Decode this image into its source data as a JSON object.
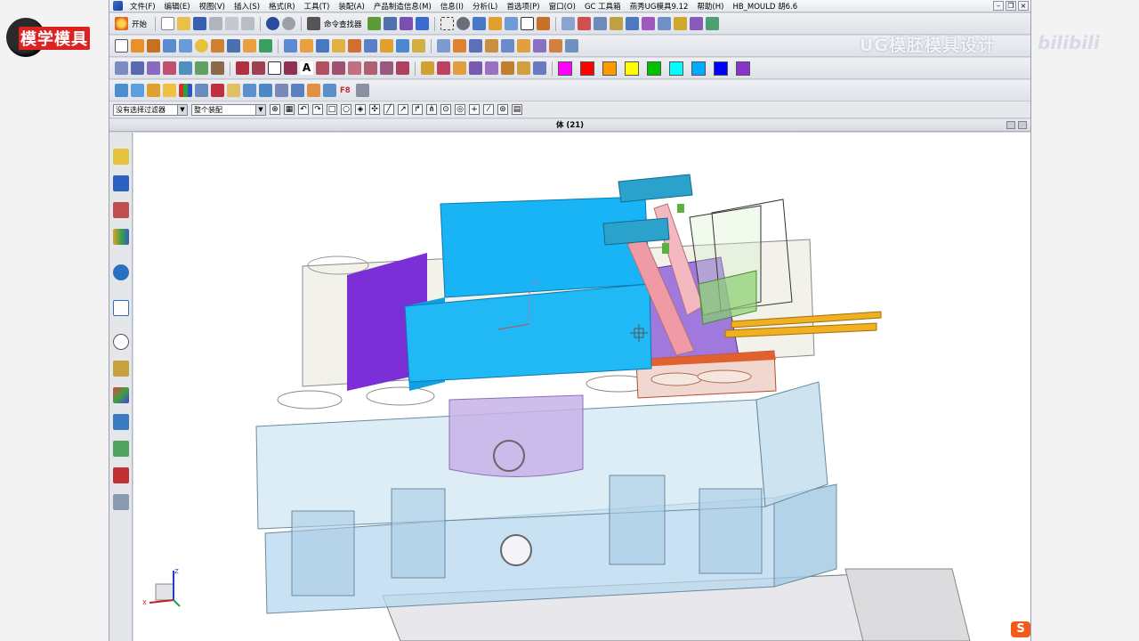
{
  "menu": {
    "items": [
      "文件(F)",
      "编辑(E)",
      "视图(V)",
      "插入(S)",
      "格式(R)",
      "工具(T)",
      "装配(A)",
      "产品制造信息(M)",
      "信息(I)",
      "分析(L)",
      "首选项(P)",
      "窗口(O)",
      "GC 工具箱",
      "燕秀UG模具9.12",
      "帮助(H)",
      "HB_MOULD 胡6.6"
    ]
  },
  "toolbar1": {
    "start_label": "开始",
    "command_finder_label": "命令查找器"
  },
  "colors": {
    "palette": [
      "#ff00ff",
      "#ff0000",
      "#ff9900",
      "#ffff00",
      "#00c000",
      "#00ffff",
      "#00aaff",
      "#0000ff",
      "#8833cc"
    ]
  },
  "filterbar": {
    "type_filter": "没有选择过滤器",
    "scope_filter": "整个装配"
  },
  "viewport": {
    "title": "体 (21)"
  },
  "watermark": {
    "logo_text": "模学模具",
    "overlay_text": "UG模胚模具设计",
    "bili_text": "bilibili"
  },
  "axes": {
    "x": "X",
    "z": "Z",
    "label_zc": "ZC"
  }
}
